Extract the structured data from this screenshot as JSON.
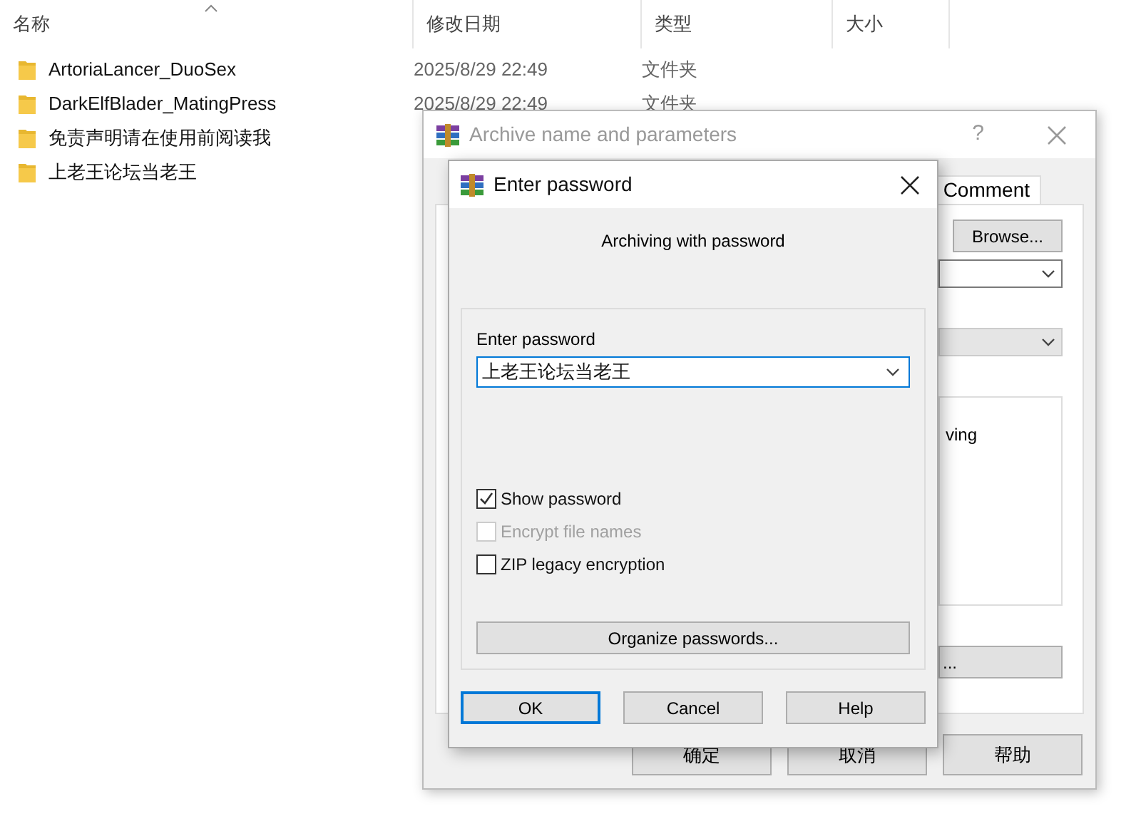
{
  "explorer": {
    "columns": [
      "名称",
      "修改日期",
      "类型",
      "大小"
    ],
    "rows": [
      {
        "name": "ArtoriaLancer_DuoSex",
        "date": "2025/8/29 22:49",
        "type": "文件夹"
      },
      {
        "name": "DarkElfBlader_MatingPress",
        "date": "2025/8/29 22:49",
        "type": "文件夹"
      },
      {
        "name": "免责声明请在使用前阅读我"
      },
      {
        "name": "上老王论坛当老王"
      }
    ]
  },
  "archive_dialog": {
    "title": "Archive name and parameters",
    "help": "?",
    "tab": "Comment",
    "browse": "Browse...",
    "partial_text": "ving",
    "partial_button": "...",
    "buttons": [
      "确定",
      "取消",
      "帮助"
    ]
  },
  "password_dialog": {
    "title": "Enter password",
    "heading": "Archiving with password",
    "label": "Enter password",
    "value": "上老王论坛当老王",
    "options": [
      {
        "label": "Show password",
        "checked": true,
        "disabled": false
      },
      {
        "label": "Encrypt file names",
        "checked": false,
        "disabled": true
      },
      {
        "label": "ZIP legacy encryption",
        "checked": false,
        "disabled": false
      }
    ],
    "organize": "Organize passwords...",
    "buttons": [
      {
        "label": "OK",
        "selected": true
      },
      {
        "label": "Cancel",
        "selected": false
      },
      {
        "label": "Help",
        "selected": false
      }
    ]
  }
}
